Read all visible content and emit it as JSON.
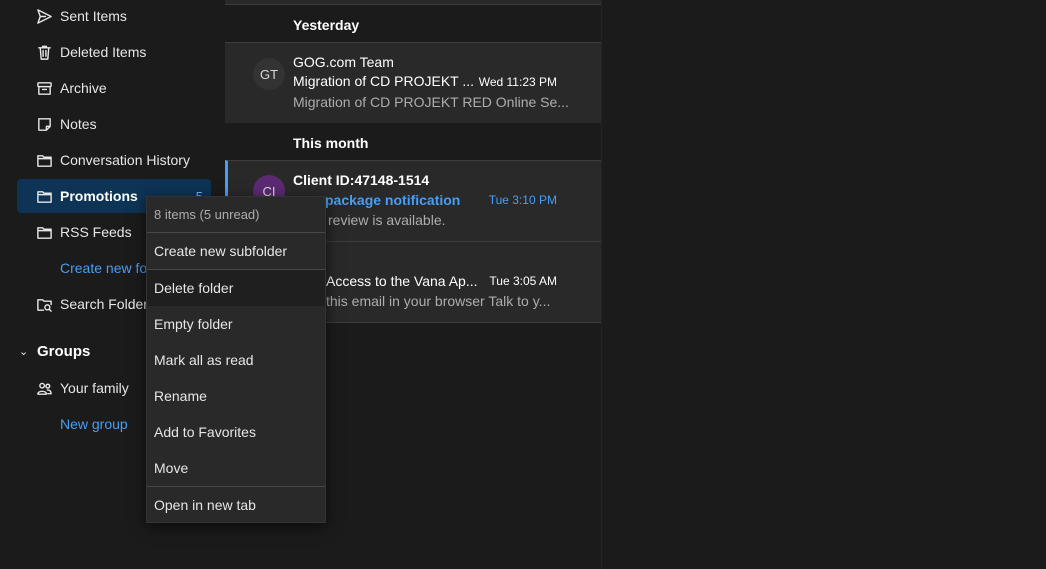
{
  "nav": {
    "items": [
      {
        "label": "Sent Items",
        "icon": "send-icon"
      },
      {
        "label": "Deleted Items",
        "icon": "trash-icon"
      },
      {
        "label": "Archive",
        "icon": "archive-icon"
      },
      {
        "label": "Notes",
        "icon": "note-icon"
      },
      {
        "label": "Conversation History",
        "icon": "folder-icon"
      },
      {
        "label": "Promotions",
        "icon": "folder-icon",
        "count": "5"
      },
      {
        "label": "RSS Feeds",
        "icon": "folder-icon"
      }
    ],
    "create_new_folder": "Create new fo",
    "search_folders": "Search Folders",
    "groups": {
      "label": "Groups",
      "items": [
        {
          "label": "Your family",
          "icon": "people-icon"
        }
      ],
      "new_group": "New group"
    }
  },
  "list": {
    "sections": [
      {
        "header": "Yesterday"
      },
      {
        "header": "This month"
      }
    ],
    "messages": [
      {
        "initials": "GT",
        "avatar_color": "#333333",
        "sender": "GOG.com Team",
        "subject": "Migration of CD PROJEKT ...",
        "time": "Wed 11:23 PM",
        "preview": "Migration of CD PROJEKT RED Online Se..."
      },
      {
        "initials": "CI",
        "avatar_color": "#5c2a73",
        "sender": "Client ID:47148-1514",
        "subject": "package notification",
        "time": "Tue 3:10 PM",
        "preview": "review is available."
      },
      {
        "subject": "Access to the Vana Ap...",
        "time": "Tue 3:05 AM",
        "preview": "this email in your browser Talk to y..."
      }
    ]
  },
  "context_menu": {
    "info": "8 items (5 unread)",
    "items": [
      "Create new subfolder",
      "Delete folder",
      "Empty folder",
      "Mark all as read",
      "Rename",
      "Add to Favorites",
      "Move",
      "Open in new tab"
    ]
  },
  "colors": {
    "accent": "#479ef5",
    "selected_bg": "#0d3455",
    "background": "#1b1b1b",
    "surface": "#292929"
  }
}
